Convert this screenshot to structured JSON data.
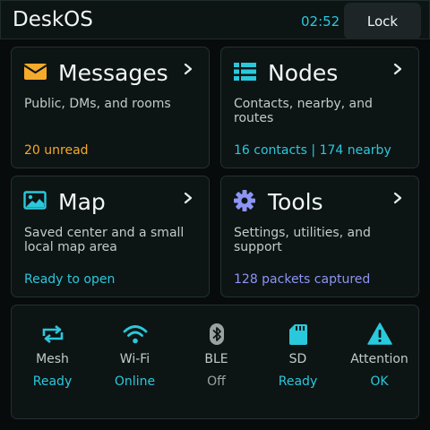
{
  "header": {
    "app_title": "DeskOS",
    "clock": "02:52",
    "lock_label": "Lock"
  },
  "cards": {
    "messages": {
      "title": "Messages",
      "description": "Public, DMs, and rooms",
      "status": "20 unread",
      "icon": "envelope-icon"
    },
    "nodes": {
      "title": "Nodes",
      "description": "Contacts, nearby, and routes",
      "status": "16 contacts | 174 nearby",
      "icon": "list-icon"
    },
    "map": {
      "title": "Map",
      "description": "Saved center and a small local map area",
      "status": "Ready to open",
      "icon": "image-icon"
    },
    "tools": {
      "title": "Tools",
      "description": "Settings, utilities, and support",
      "status": "128 packets captured",
      "icon": "gear-icon"
    }
  },
  "status_bar": {
    "mesh": {
      "label": "Mesh",
      "value": "Ready",
      "icon": "retweet-icon"
    },
    "wifi": {
      "label": "Wi-Fi",
      "value": "Online",
      "icon": "wifi-icon"
    },
    "ble": {
      "label": "BLE",
      "value": "Off",
      "icon": "bluetooth-icon"
    },
    "sd": {
      "label": "SD",
      "value": "Ready",
      "icon": "sd-card-icon"
    },
    "attention": {
      "label": "Attention",
      "value": "OK",
      "icon": "warning-icon"
    }
  },
  "colors": {
    "accent_cyan": "#2ac8dc",
    "accent_orange": "#f4aa2a",
    "accent_purple": "#8c95f4",
    "muted_grey": "#9aa3a3"
  }
}
